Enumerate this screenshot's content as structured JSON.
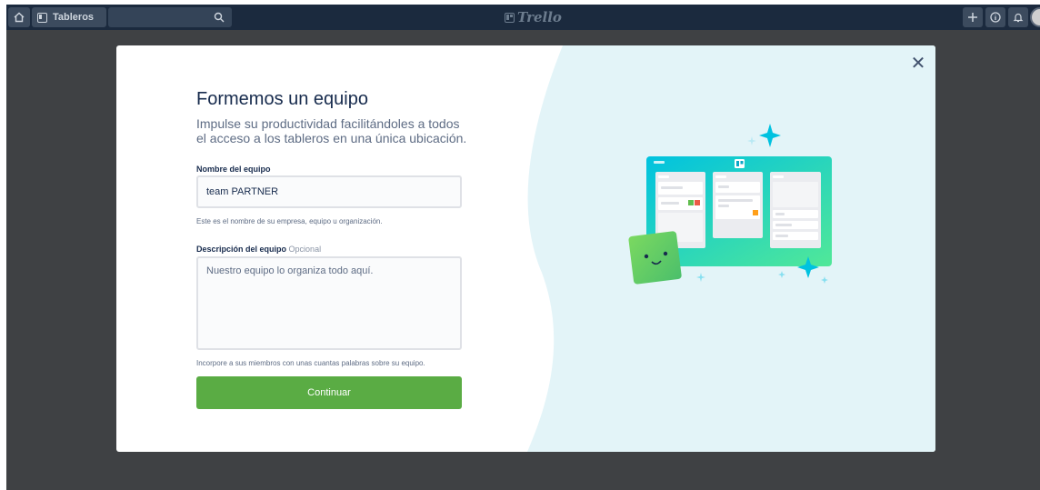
{
  "topbar": {
    "home_icon": "home-icon",
    "boards_label": "Tableros",
    "search_icon": "search-icon",
    "logo_text": "Trello",
    "plus_icon": "plus-icon",
    "info_icon": "info-icon",
    "bell_icon": "bell-icon",
    "colors": {
      "bar": "#1b2a3e",
      "button": "#3c4b5e"
    }
  },
  "modal": {
    "title": "Formemos un equipo",
    "subtitle": "Impulse su productividad facilitándoles a todos el acceso a los tableros en una única ubicación.",
    "team_name": {
      "label": "Nombre del equipo",
      "value": "team PARTNER",
      "hint": "Este es el nombre de su empresa, equipo u organización."
    },
    "team_description": {
      "label": "Descripción del equipo",
      "optional": "Opcional",
      "placeholder": "Nuestro equipo lo organiza todo aquí.",
      "hint": "Incorpore a sus miembros con unas cuantas palabras sobre su equipo."
    },
    "continue_label": "Continuar",
    "close_icon": "close-icon",
    "colors": {
      "primary": "#5aac44",
      "illustration_bg": "#e3f4f8"
    }
  }
}
